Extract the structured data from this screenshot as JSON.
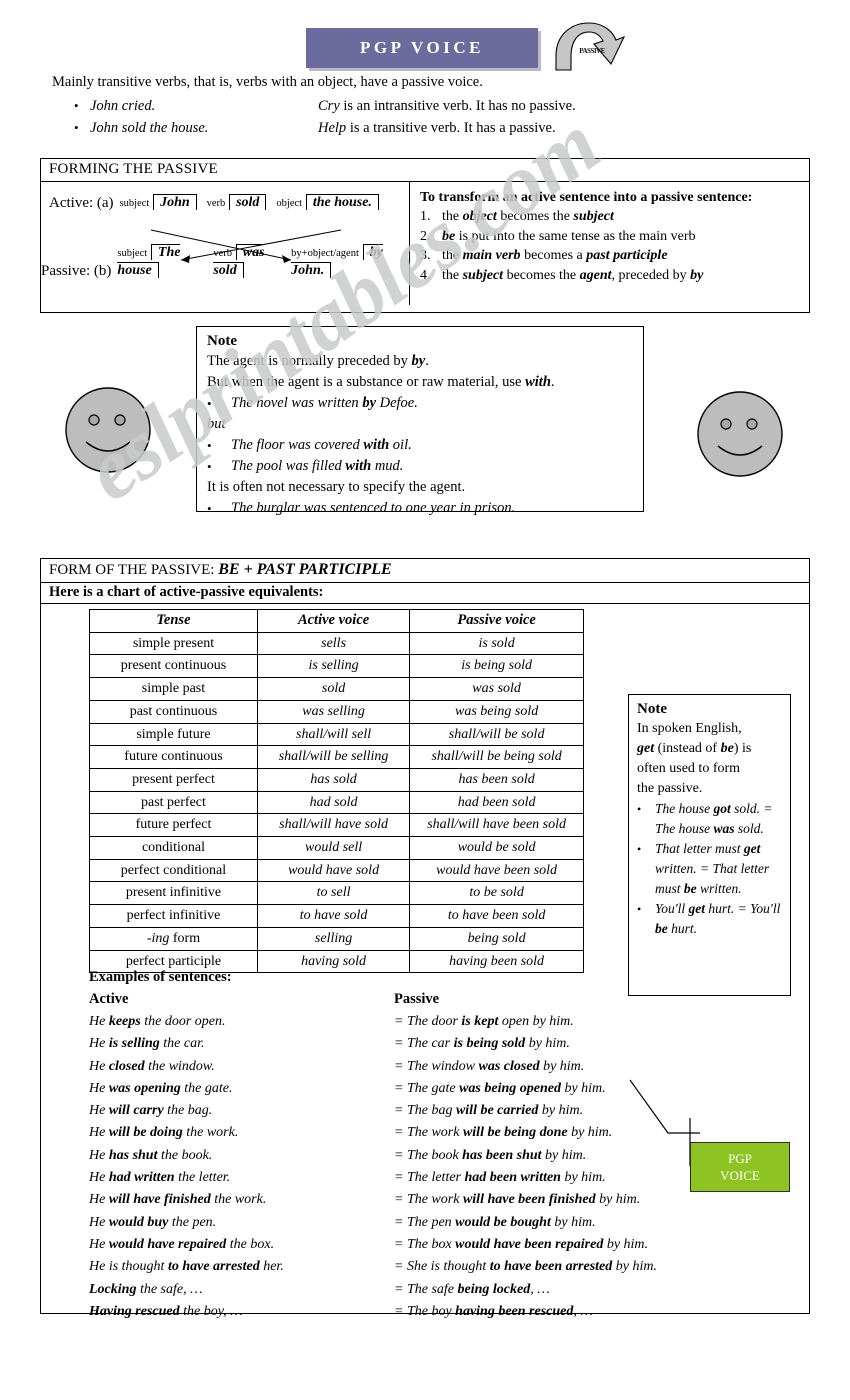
{
  "title_banner": {
    "text": "PGP VOICE",
    "color": "#6b6b9e",
    "arrow_label": "PASSIVE"
  },
  "watermark": {
    "text": "eslprintables.com",
    "color": "#c9cccb"
  },
  "intro": {
    "lead": "Mainly transitive verbs, that is, verbs with an object, have a passive voice.",
    "bullets": [
      {
        "dot": "•",
        "example": "John  cried.",
        "note_term": "Cry",
        "note_rest": " is an intransitive verb. It has no passive."
      },
      {
        "dot": "•",
        "example": "John sold the house.",
        "note_term": "Help",
        "note_rest": " is a transitive verb. It has a passive."
      }
    ]
  },
  "forming": {
    "heading": "FORMING THE PASSIVE",
    "active_label": "Active: (a)",
    "passive_label": "Passive: (b)",
    "active_slots": [
      {
        "tag": "subject",
        "value": "John"
      },
      {
        "tag": "verb",
        "value": "sold"
      },
      {
        "tag": "object",
        "value": "the house."
      }
    ],
    "passive_slots": [
      {
        "tag": "subject",
        "value": "The house"
      },
      {
        "tag": "verb",
        "value": "was sold"
      },
      {
        "tag": "by+object/agent",
        "value": "by John."
      }
    ],
    "rules_title": "To transform an active sentence into a passive sentence:",
    "rules": [
      {
        "num": "1.",
        "pre": "the ",
        "b1": "object",
        "mid": " becomes the ",
        "b2": "subject",
        "post": ""
      },
      {
        "num": "2.",
        "pre": "",
        "b1": "be",
        "mid": " is put into the same tense as the main verb",
        "b2": "",
        "post": ""
      },
      {
        "num": "3.",
        "pre": "the ",
        "b1": "main verb",
        "mid": " becomes a ",
        "b2": "past participle",
        "post": ""
      },
      {
        "num": "4.",
        "pre": "the ",
        "b1": "subject",
        "mid": " becomes the ",
        "b2": "agent",
        "post": ", preceded by ",
        "b3": "by"
      }
    ]
  },
  "note1": {
    "title": "Note",
    "line1_pre": "The agent is normally preceded by ",
    "line1_term": "by",
    "line1_post": ".",
    "line2_pre": "But when the agent is a substance or raw material, use ",
    "line2_term": "with",
    "line2_post": ".",
    "bullet1_pre": "The novel was written ",
    "bullet1_term": "by",
    "bullet1_post": " Defoe.",
    "but": "but",
    "bullet2_pre": " The floor was covered ",
    "bullet2_term": "with",
    "bullet2_post": " oil.",
    "bullet3_pre": "The pool was filled ",
    "bullet3_term": "with",
    "bullet3_post": " mud.",
    "line3": "It is often not necessary to specify the agent.",
    "bullet4": "The burglar was sentenced to one year in prison."
  },
  "form_section": {
    "heading_plain": "FORM OF THE PASSIVE: ",
    "heading_italic": "BE + PAST PARTICIPLE",
    "chart_intro": "Here is a chart of active-passive equivalents:",
    "columns": [
      "Tense",
      "Active voice",
      "Passive voice"
    ],
    "rows": [
      {
        "tense": "simple present",
        "active": "sells",
        "passive": "is sold"
      },
      {
        "tense": "present continuous",
        "active": "is selling",
        "passive": "is being sold"
      },
      {
        "tense": "simple past",
        "active": "sold",
        "passive": "was sold"
      },
      {
        "tense": "past continuous",
        "active": "was selling",
        "passive": "was being sold"
      },
      {
        "tense": "simple future",
        "active": "shall/will sell",
        "passive": "shall/will be sold"
      },
      {
        "tense": "future continuous",
        "active": "shall/will be selling",
        "passive": "shall/will be being sold"
      },
      {
        "tense": "present perfect",
        "active": "has sold",
        "passive": "has been sold"
      },
      {
        "tense": "past perfect",
        "active": "had sold",
        "passive": "had been sold"
      },
      {
        "tense": "future perfect",
        "active": "shall/will have sold",
        "passive": "shall/will have been sold"
      },
      {
        "tense": "conditional",
        "active": "would sell",
        "passive": "would be sold"
      },
      {
        "tense": "perfect conditional",
        "active": "would have sold",
        "passive": "would have been sold"
      },
      {
        "tense": "present infinitive",
        "active": "to sell",
        "passive": "to be sold"
      },
      {
        "tense": "perfect infinitive",
        "active": "to have sold",
        "passive": "to have been sold"
      },
      {
        "tense": "-ing form",
        "active": "selling",
        "passive": "being sold"
      },
      {
        "tense": "perfect participle",
        "active": "having sold",
        "passive": "having been sold"
      }
    ]
  },
  "note2": {
    "title": "Note",
    "line1": "In spoken English,",
    "line2_term1": "get",
    "line2_mid": " (instead of ",
    "line2_term2": "be",
    "line2_post": ") is",
    "line3": "often used to form",
    "line4": "the passive.",
    "bullets": [
      "The house got sold. = The house was sold.",
      "That letter must get written. = That letter must be written.",
      "You'll get hurt. = You'll be hurt."
    ]
  },
  "examples": {
    "title": "Examples of sentences:",
    "col_active": "Active",
    "col_passive": "Passive",
    "rows": [
      {
        "active": "He keeps the door open.",
        "passive": "= The door is kept open by him."
      },
      {
        "active": "He is selling the car.",
        "passive": "= The car is being sold by him."
      },
      {
        "active": "He closed the window.",
        "passive": "= The window was closed by him."
      },
      {
        "active": "He was opening the gate.",
        "passive": "= The gate was being opened by him."
      },
      {
        "active": "He will carry the bag.",
        "passive": "= The bag will be carried by him."
      },
      {
        "active": "He will be doing the work.",
        "passive": "= The work will be being done by him."
      },
      {
        "active": "He has shut the book.",
        "passive": "= The book has been shut by him."
      },
      {
        "active": "He had written the letter.",
        "passive": "= The letter had been written by him."
      },
      {
        "active": "He will have finished the work.",
        "passive": "= The work will have been finished by him."
      },
      {
        "active": "He would buy the pen.",
        "passive": "= The pen would be bought by him."
      },
      {
        "active": "He would have repaired the box.",
        "passive": "= The box would have been repaired by him."
      },
      {
        "active": "He is thought to have arrested her.",
        "passive": "= She is thought to have been arrested by him."
      },
      {
        "active": "Locking the safe, …",
        "passive": "= The safe being locked, …"
      },
      {
        "active": "Having rescued the boy, …",
        "passive": "= The boy having been rescued, …"
      }
    ]
  },
  "green_badge": {
    "line1": "PGP",
    "line2": "VOICE",
    "color": "#8dc424"
  }
}
